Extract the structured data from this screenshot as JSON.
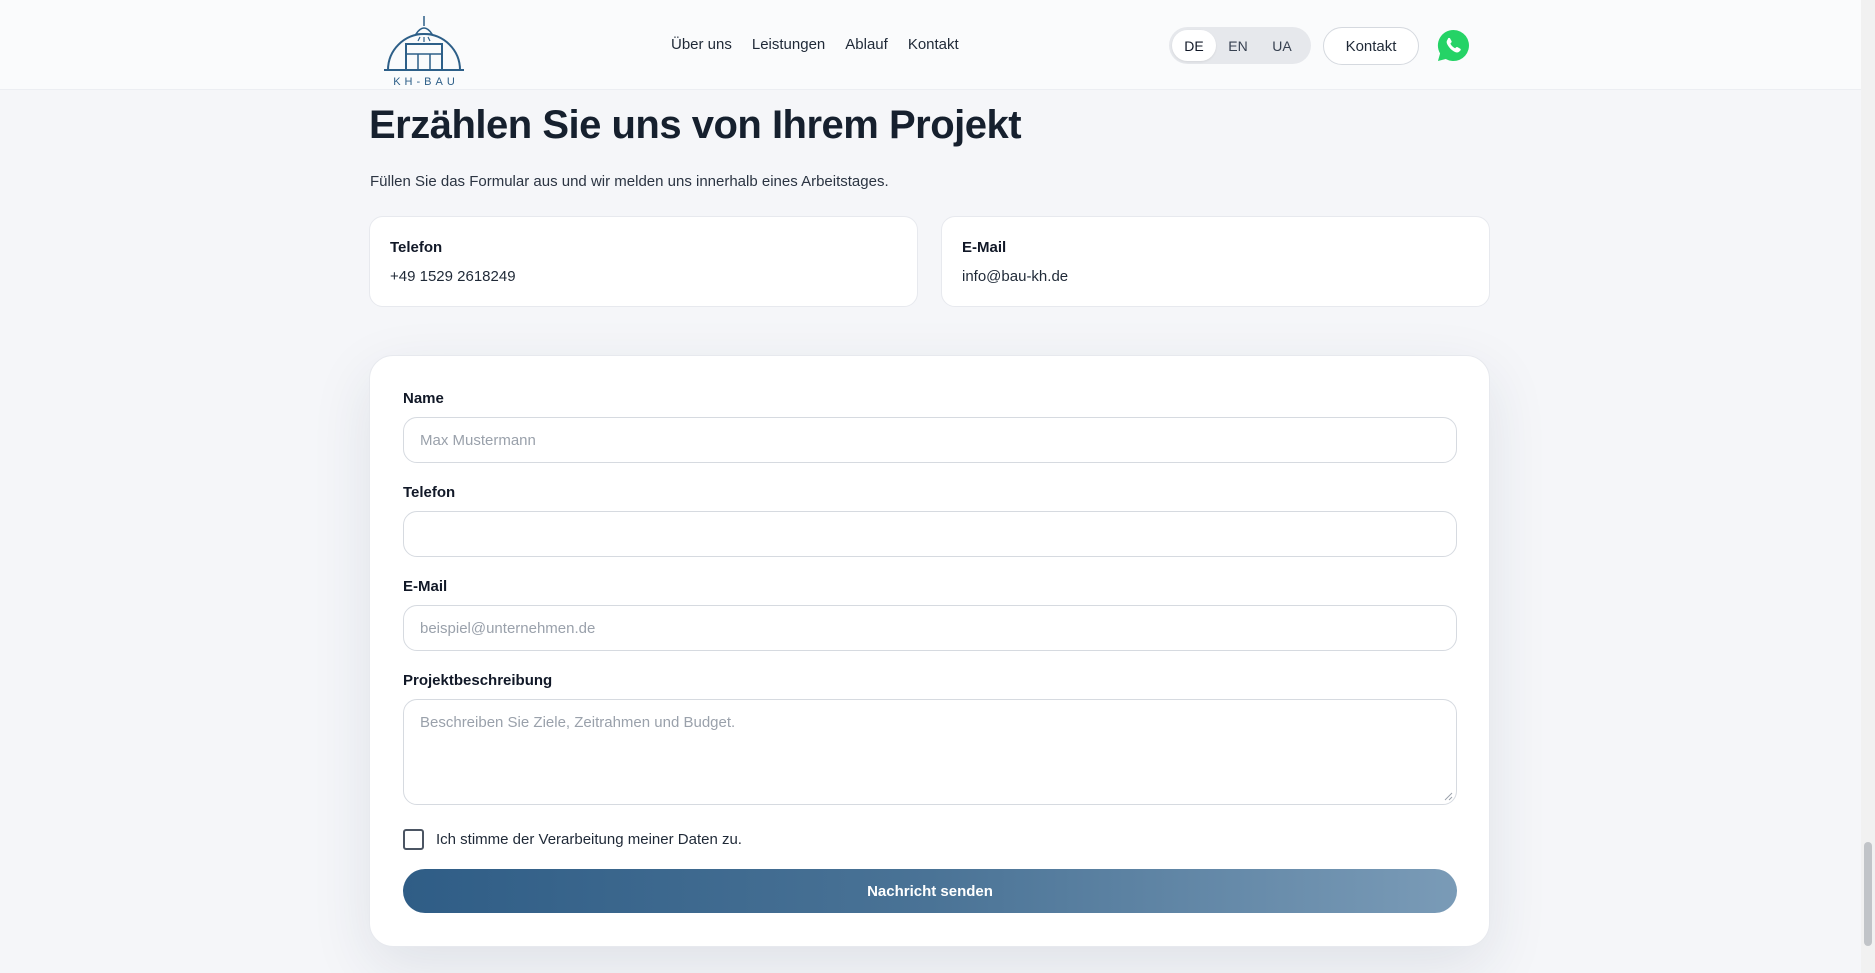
{
  "header": {
    "logo_text": "KH-BAU",
    "nav": [
      "Über uns",
      "Leistungen",
      "Ablauf",
      "Kontakt"
    ],
    "languages": [
      "DE",
      "EN",
      "UA"
    ],
    "active_language": "DE",
    "contact_button": "Kontakt",
    "whatsapp_icon": "whatsapp-icon"
  },
  "intro": {
    "title": "Erzählen Sie uns von Ihrem Projekt",
    "subtitle": "Füllen Sie das Formular aus und wir melden uns innerhalb eines Arbeitstages."
  },
  "contact_cards": [
    {
      "label": "Telefon",
      "value": "+49 1529 2618249"
    },
    {
      "label": "E-Mail",
      "value": "info@bau-kh.de"
    }
  ],
  "form": {
    "name_label": "Name",
    "name_placeholder": "Max Mustermann",
    "phone_label": "Telefon",
    "phone_placeholder": "",
    "email_label": "E-Mail",
    "email_placeholder": "beispiel@unternehmen.de",
    "description_label": "Projektbeschreibung",
    "description_placeholder": "Beschreiben Sie Ziele, Zeitrahmen und Budget.",
    "consent_label": "Ich stimme der Verarbeitung meiner Daten zu.",
    "consent_checked": false,
    "submit_label": "Nachricht senden"
  },
  "colors": {
    "brand": "#2d5f88",
    "background": "#f5f6f9",
    "whatsapp": "#25d366",
    "button_gradient_start": "#2f5d86",
    "button_gradient_end": "#7a9bb7"
  }
}
